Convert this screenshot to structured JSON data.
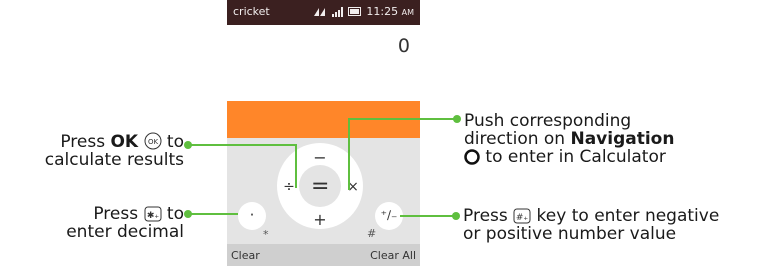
{
  "status_bar": {
    "carrier": "cricket",
    "time": "11:25",
    "ampm": "AM"
  },
  "display": {
    "value": "0"
  },
  "keypad": {
    "up": "−",
    "down": "+",
    "left": "÷",
    "right": "×",
    "center": "=",
    "decimal_key": "·",
    "decimal_hint": "*",
    "sign_key": "⁺∕₋",
    "sign_hint": "#"
  },
  "softkeys": {
    "left": "Clear",
    "right": "Clear All"
  },
  "callouts": {
    "ok": {
      "prefix": "Press ",
      "bold": "OK",
      "suffix": " to",
      "line2": "calculate results"
    },
    "decimal": {
      "prefix": "Press ",
      "suffix": " to",
      "line2": "enter decimal"
    },
    "navigation": {
      "line1": "Push corresponding",
      "line2_prefix": "direction on ",
      "line2_bold": "Navigation",
      "line3": " to enter in Calculator"
    },
    "negative": {
      "prefix": "Press ",
      "suffix": " key to enter negative",
      "line2": "or positive number value"
    }
  },
  "colors": {
    "accent_orange": "#ff8629",
    "callout_green": "#5fbf3f",
    "status_bar": "#3b2020"
  }
}
